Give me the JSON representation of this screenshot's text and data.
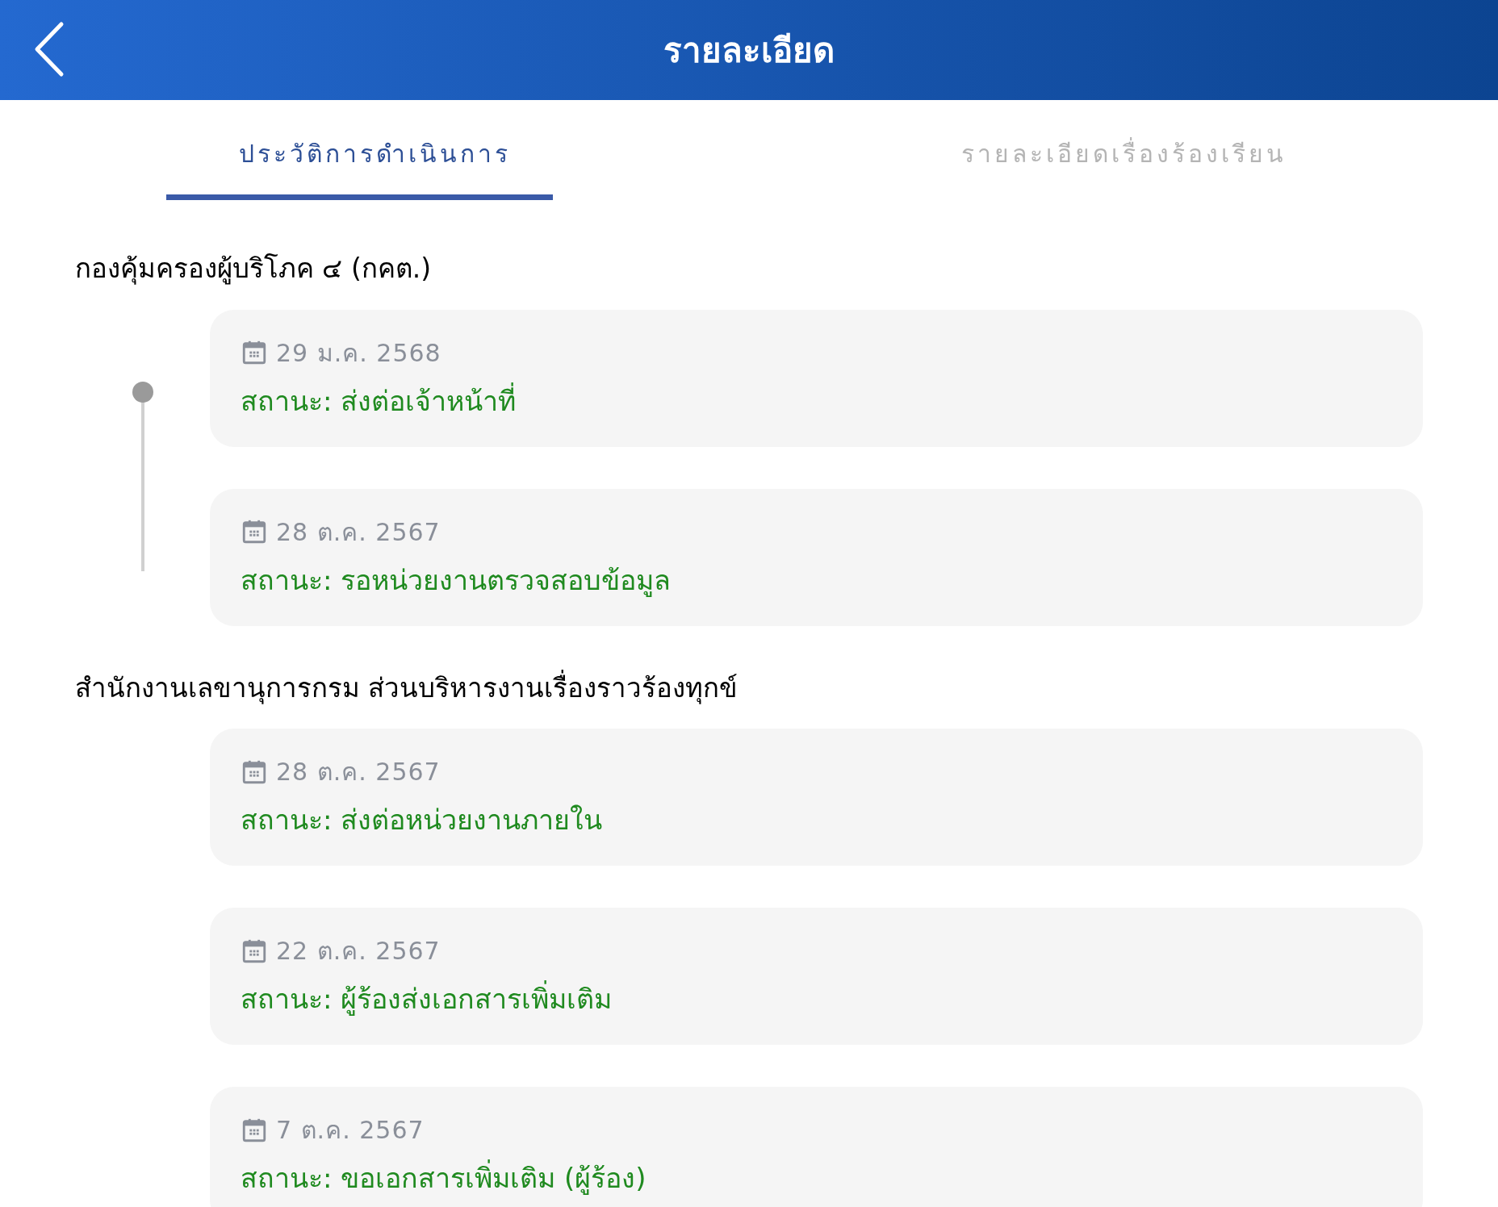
{
  "header": {
    "title": "รายละเอียด"
  },
  "tabs": [
    {
      "label": "ประวัติการดำเนินการ",
      "selected": true
    },
    {
      "label": "รายละเอียดเรื่องร้องเรียน",
      "selected": false
    }
  ],
  "groups": [
    {
      "title": "กองคุ้มครองผู้บริโภค ๔ (กคต.)",
      "timeline": true,
      "entries": [
        {
          "date": "29 ม.ค. 2568",
          "status": "สถานะ: ส่งต่อเจ้าหน้าที่"
        },
        {
          "date": "28 ต.ค. 2567",
          "status": "สถานะ: รอหน่วยงานตรวจสอบข้อมูล"
        }
      ]
    },
    {
      "title": "สำนักงานเลขานุการกรม ส่วนบริหารงานเรื่องราวร้องทุกข์",
      "timeline": false,
      "entries": [
        {
          "date": "28 ต.ค. 2567",
          "status": "สถานะ: ส่งต่อหน่วยงานภายใน"
        },
        {
          "date": "22 ต.ค. 2567",
          "status": "สถานะ: ผู้ร้องส่งเอกสารเพิ่มเติม"
        },
        {
          "date": "7 ต.ค. 2567",
          "status": "สถานะ: ขอเอกสารเพิ่มเติม (ผู้ร้อง)"
        }
      ]
    }
  ]
}
